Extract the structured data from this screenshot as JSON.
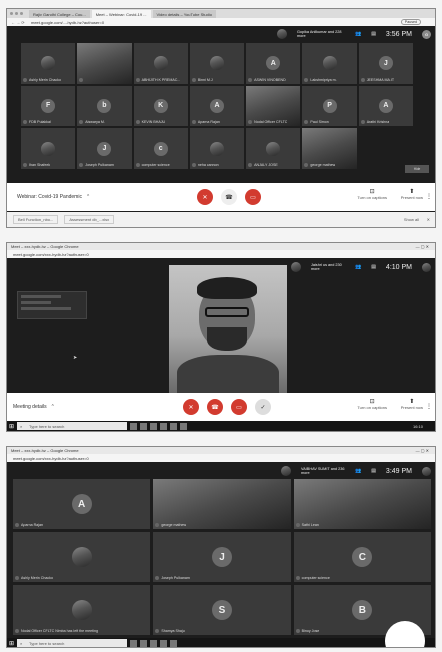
{
  "shot1": {
    "tabs": [
      "Rajiv Gandhi College – Cou...",
      "Meet – Webinar: Covid-19 ...",
      "Video details – YouTube Studio"
    ],
    "address": "meet.google.com/...-hydb-hz?authuser=0",
    "paused_label": "Paused",
    "presenter_text": "Gopika Anilkumar and 228 more",
    "time": "3:56 PM",
    "participants": [
      {
        "name": "Ashly Merin Chacko",
        "letter": "",
        "kind": "photo"
      },
      {
        "name": "",
        "letter": "",
        "kind": "video"
      },
      {
        "name": "ABHIJITH K PREMAC...",
        "letter": "",
        "kind": "photo"
      },
      {
        "name": "Binni M.J",
        "letter": "",
        "kind": "photo"
      },
      {
        "name": "ASWIN VINOBEND",
        "letter": "A",
        "kind": "letter"
      },
      {
        "name": "Lakshmipriya m.",
        "letter": "",
        "kind": "photo"
      },
      {
        "name": "JEESHMA MA.IT",
        "letter": "J",
        "kind": "letter"
      },
      {
        "name": "FDB Pulakkal",
        "letter": "F",
        "kind": "letter"
      },
      {
        "name": "Aiswarya M.",
        "letter": "b",
        "kind": "letter"
      },
      {
        "name": "KEVIN BHAJU",
        "letter": "K",
        "kind": "letter"
      },
      {
        "name": "Aparna Rajan",
        "letter": "A",
        "kind": "letter"
      },
      {
        "name": "Nodal Officer CFLTC",
        "letter": "",
        "kind": "video"
      },
      {
        "name": "Paul Simon",
        "letter": "P",
        "kind": "letter"
      },
      {
        "name": "Arathi Krishna",
        "letter": "A",
        "kind": "letter"
      },
      {
        "name": "Ihan Shafeek",
        "letter": "",
        "kind": "photo"
      },
      {
        "name": "Joseph Pulkanam",
        "letter": "J",
        "kind": "letter"
      },
      {
        "name": "computer science",
        "letter": "c",
        "kind": "letter"
      },
      {
        "name": "neha cannon",
        "letter": "",
        "kind": "photo"
      },
      {
        "name": "ANJALY JOSE",
        "letter": "",
        "kind": "photo"
      },
      {
        "name": "george mathew",
        "letter": "",
        "kind": "video"
      }
    ],
    "meeting_title": "Webinar: Covid-19 Pandemic",
    "captions_label": "Turn on captions",
    "present_label": "Present now",
    "download1": "Bell Function_nbo...",
    "download2": "Assessment db_...xlsx",
    "show_all": "Show all"
  },
  "shot2": {
    "window_title": "Meet – xxx-hydb-hz – Google Chrome",
    "address": "meet.google.com/xxx-hydb-hz?authuser=0",
    "presenter_text": "Jaishri us and 230 more",
    "time": "4:10 PM",
    "meeting_details": "Meeting details",
    "captions_label": "Turn on captions",
    "present_label": "Present now",
    "search_placeholder": "Type here to search",
    "clock": "16:10"
  },
  "shot3": {
    "window_title": "Meet – xxx-hydb-hz – Google Chrome",
    "address": "meet.google.com/xxx-hydb-hz?authuser=0",
    "presenter_text": "VAIBHAV SUMIT and 236 more",
    "time": "3:49 PM",
    "participants": [
      {
        "name": "Aparna Rajan",
        "letter": "A",
        "kind": "letter"
      },
      {
        "name": "george mathew",
        "letter": "",
        "kind": "video"
      },
      {
        "name": "Sathi Lean",
        "letter": "",
        "kind": "video"
      },
      {
        "name": "Ashly Merin Chacko",
        "letter": "",
        "kind": "photo"
      },
      {
        "name": "Joseph Pulkanam",
        "letter": "J",
        "kind": "letter"
      },
      {
        "name": "computer science",
        "letter": "C",
        "kind": "letter"
      },
      {
        "name": "Nodal Officer CFLTC Nimba has left the meeting",
        "letter": "",
        "kind": "photo"
      },
      {
        "name": "Shamya Shaju",
        "letter": "S",
        "kind": "letter"
      },
      {
        "name": "Binoy Jose",
        "letter": "B",
        "kind": "letter"
      }
    ],
    "bottom_name": "Annadha. A Santhosh",
    "search_placeholder": "Type here to search"
  },
  "colors": {
    "end_call": "#d23b2f",
    "avatar_gray": "#6a6a6a",
    "meet_bar": "#ffffff"
  }
}
